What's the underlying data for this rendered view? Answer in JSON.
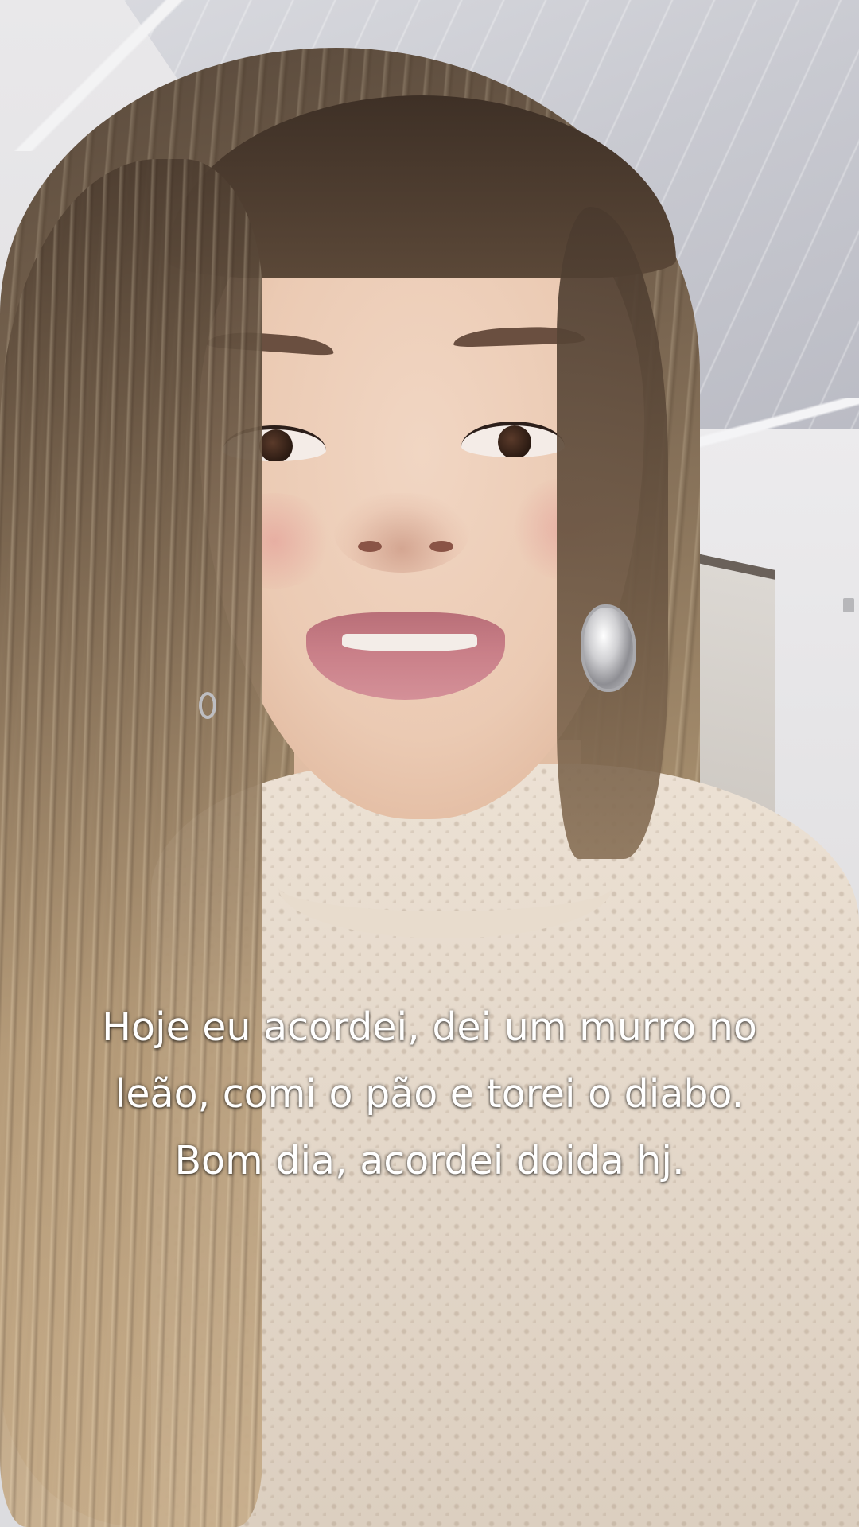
{
  "video": {
    "caption": {
      "lines": [
        "Hoje eu acordei, dei um murro no",
        "leão, comi o pão e torei o diabo.",
        "Bom dia, acordei doida hj."
      ]
    }
  }
}
